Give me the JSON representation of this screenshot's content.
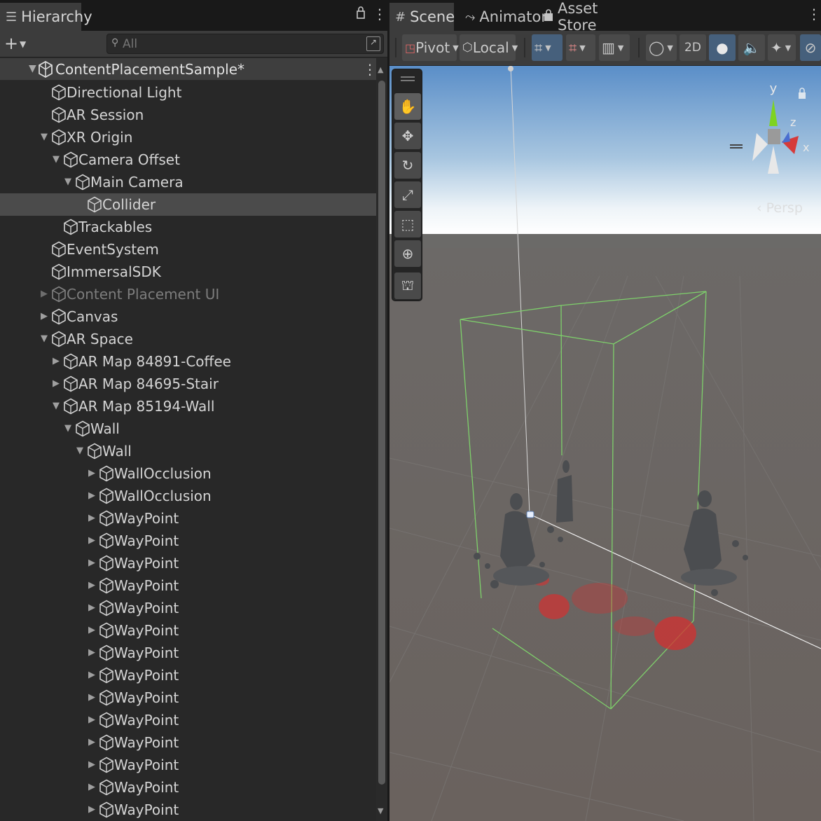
{
  "hierarchy": {
    "tab_label": "Hierarchy",
    "add_label": "+",
    "search_placeholder": "All",
    "scene_name": "ContentPlacementSample*",
    "items": [
      {
        "label": "Directional Light",
        "depth": 1,
        "arrow": "none"
      },
      {
        "label": "AR Session",
        "depth": 1,
        "arrow": "none"
      },
      {
        "label": "XR Origin",
        "depth": 1,
        "arrow": "expanded"
      },
      {
        "label": "Camera Offset",
        "depth": 2,
        "arrow": "expanded"
      },
      {
        "label": "Main Camera",
        "depth": 3,
        "arrow": "expanded"
      },
      {
        "label": "Collider",
        "depth": 4,
        "arrow": "none",
        "selected": true
      },
      {
        "label": "Trackables",
        "depth": 2,
        "arrow": "none"
      },
      {
        "label": "EventSystem",
        "depth": 1,
        "arrow": "none"
      },
      {
        "label": "ImmersalSDK",
        "depth": 1,
        "arrow": "none"
      },
      {
        "label": "Content Placement UI",
        "depth": 1,
        "arrow": "collapsed",
        "disabled": true
      },
      {
        "label": "Canvas",
        "depth": 1,
        "arrow": "collapsed"
      },
      {
        "label": "AR Space",
        "depth": 1,
        "arrow": "expanded"
      },
      {
        "label": "AR Map 84891-Coffee",
        "depth": 2,
        "arrow": "collapsed"
      },
      {
        "label": "AR Map 84695-Stair",
        "depth": 2,
        "arrow": "collapsed"
      },
      {
        "label": "AR Map 85194-Wall",
        "depth": 2,
        "arrow": "expanded"
      },
      {
        "label": "Wall",
        "depth": 3,
        "arrow": "expanded"
      },
      {
        "label": "Wall",
        "depth": 4,
        "arrow": "expanded"
      },
      {
        "label": "WallOcclusion",
        "depth": 5,
        "arrow": "collapsed"
      },
      {
        "label": "WallOcclusion",
        "depth": 5,
        "arrow": "collapsed"
      },
      {
        "label": "WayPoint",
        "depth": 5,
        "arrow": "collapsed"
      },
      {
        "label": "WayPoint",
        "depth": 5,
        "arrow": "collapsed"
      },
      {
        "label": "WayPoint",
        "depth": 5,
        "arrow": "collapsed"
      },
      {
        "label": "WayPoint",
        "depth": 5,
        "arrow": "collapsed"
      },
      {
        "label": "WayPoint",
        "depth": 5,
        "arrow": "collapsed"
      },
      {
        "label": "WayPoint",
        "depth": 5,
        "arrow": "collapsed"
      },
      {
        "label": "WayPoint",
        "depth": 5,
        "arrow": "collapsed"
      },
      {
        "label": "WayPoint",
        "depth": 5,
        "arrow": "collapsed"
      },
      {
        "label": "WayPoint",
        "depth": 5,
        "arrow": "collapsed"
      },
      {
        "label": "WayPoint",
        "depth": 5,
        "arrow": "collapsed"
      },
      {
        "label": "WayPoint",
        "depth": 5,
        "arrow": "collapsed"
      },
      {
        "label": "WayPoint",
        "depth": 5,
        "arrow": "collapsed"
      },
      {
        "label": "WayPoint",
        "depth": 5,
        "arrow": "collapsed"
      },
      {
        "label": "WayPoint",
        "depth": 5,
        "arrow": "collapsed"
      }
    ]
  },
  "scene": {
    "tabs": {
      "scene": "Scene",
      "animator": "Animator",
      "asset_store": "Asset Store"
    },
    "toolbar": {
      "pivot": "Pivot",
      "local": "Local",
      "mode_2d": "2D"
    },
    "gizmo": {
      "y": "y",
      "z": "z",
      "x": "x",
      "projection": "Persp"
    },
    "tools": [
      "hand-tool",
      "move-tool",
      "rotate-tool",
      "scale-tool",
      "rect-tool",
      "transform-tool",
      "custom-tool"
    ]
  },
  "colors": {
    "bounding_box": "#7ed06b",
    "selection_blue": "#46607c",
    "point_cloud": "#d33030"
  }
}
